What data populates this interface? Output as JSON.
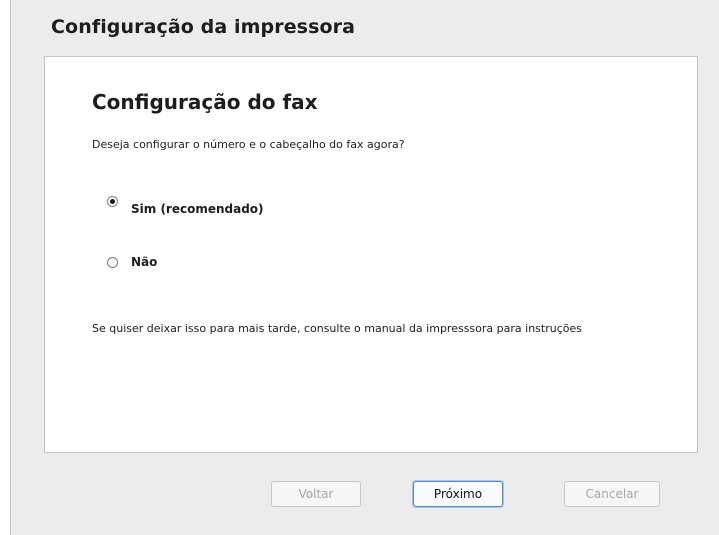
{
  "window": {
    "title": "Configuração da impressora"
  },
  "panel": {
    "heading": "Configuração do fax",
    "question": "Deseja configurar o número e o cabeçalho do fax agora?",
    "options": [
      {
        "label": "Sim (recomendado)",
        "selected": true
      },
      {
        "label": "Não",
        "selected": false
      }
    ],
    "note": "Se quiser deixar isso para mais tarde, consulte o manual da impresssora para instruções"
  },
  "buttons": {
    "back_label": "Voltar",
    "next_label": "Próximo",
    "cancel_label": "Cancelar"
  }
}
